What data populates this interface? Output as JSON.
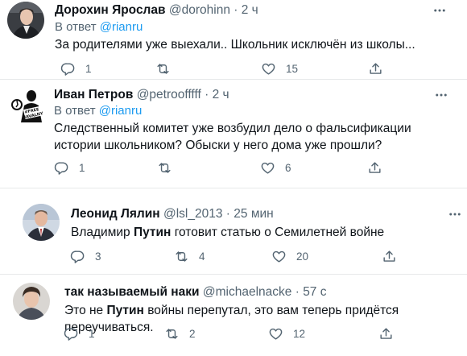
{
  "tweets": [
    {
      "name": "Дорохин Ярослав",
      "handle": "@dorohinn",
      "dot": "·",
      "time": "2 ч",
      "reply_prefix": "В ответ",
      "reply_to": "@rianru",
      "text": "За родителями уже выехали.. Школьник исключён из школы...",
      "reply_count": "1",
      "retweet_count": "",
      "like_count": "15"
    },
    {
      "name": "Иван Петров",
      "handle": "@petroofffff",
      "dot": "·",
      "time": "2 ч",
      "reply_prefix": "В ответ",
      "reply_to": "@rianru",
      "text": "Следственный комитет уже возбудил дело о фальсификации истории школьником? Обыски у него дома уже прошли?",
      "avatar_text": "#FREE NAVALNY",
      "reply_count": "1",
      "retweet_count": "",
      "like_count": "6"
    },
    {
      "name": "Леонид Лялин",
      "handle": "@lsl_2013",
      "dot": "·",
      "time": "25 мин",
      "text_pre": "Владимир ",
      "text_bold": "Путин",
      "text_post": " готовит статью о Семилетней войне",
      "reply_count": "3",
      "retweet_count": "4",
      "like_count": "20"
    },
    {
      "name": "так называемый наки",
      "handle": "@michaelnacke",
      "dot": "·",
      "time": "57 с",
      "text_pre": "Это не ",
      "text_bold": "Путин",
      "text_post": " войны перепутал, это вам теперь придётся переучиваться.",
      "reply_count": "1",
      "retweet_count": "2",
      "like_count": "12"
    }
  ],
  "colors": {
    "link": "#1d9bf0",
    "secondary": "#536471",
    "primary": "#0f1419",
    "separator": "#e7e9ea"
  },
  "icons": {
    "reply": "reply-icon",
    "retweet": "retweet-icon",
    "like": "heart-icon",
    "share": "share-icon",
    "more": "more-icon"
  }
}
